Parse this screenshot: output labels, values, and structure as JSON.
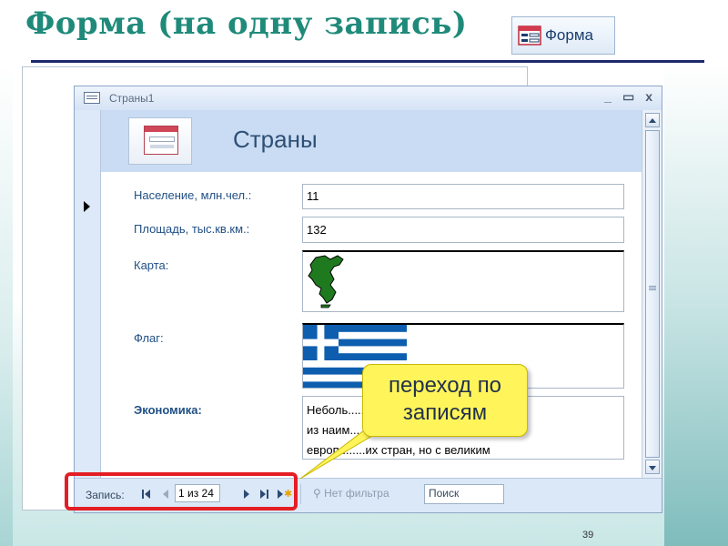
{
  "slide": {
    "title": "Форма (на одну запись)",
    "page_number": "39"
  },
  "ribbon_button": {
    "label": "Форма",
    "icon": "form-icon"
  },
  "window": {
    "title": "Страны1",
    "controls": {
      "minimize": "_",
      "maximize": "▭",
      "close": "x"
    }
  },
  "form": {
    "header_title": "Страны",
    "fields": [
      {
        "label": "Население, млн.чел.:",
        "value": "11"
      },
      {
        "label": "Площадь, тыс.кв.км.:",
        "value": "132"
      }
    ],
    "map_label": "Карта:",
    "flag_label": "Флаг:",
    "economy_label": "Экономика:",
    "economy_lines": [
      "Неболь...............................опы, одна",
      " из наим...",
      "европ........их стран, но с великим"
    ]
  },
  "navigation": {
    "record_label": "Запись:",
    "current": "1 из 24",
    "filter_label": "Нет фильтра",
    "search_label": "Поиск"
  },
  "callout": {
    "line1": "переход по",
    "line2": "записям"
  },
  "colors": {
    "title": "#1f8a7a",
    "highlight": "#e31e24",
    "callout_bg": "#fff45a",
    "flag_blue": "#0d5eaf",
    "map_green": "#1f7a1f"
  }
}
